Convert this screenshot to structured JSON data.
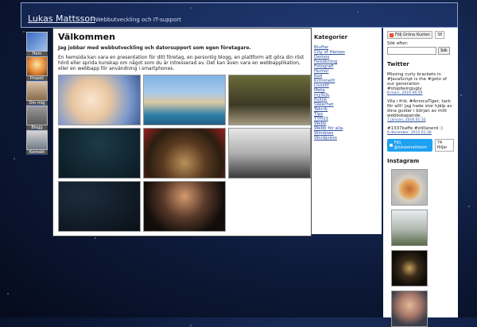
{
  "header": {
    "title": "Lukas Mattsson",
    "tagline": "- Webbutveckling och IT-support"
  },
  "nav": [
    {
      "label": "Hem",
      "icon": "home-icon"
    },
    {
      "label": "Projekt",
      "icon": "project-icon"
    },
    {
      "label": "Om mig",
      "icon": "about-icon"
    },
    {
      "label": "Blogg",
      "icon": "blog-icon"
    },
    {
      "label": "Kontakt",
      "icon": "contact-icon"
    }
  ],
  "main": {
    "title": "Välkommen",
    "lead": "Jag jobbar med webbutveckling och datorsupport som egen företagare.",
    "intro": "En hemsida kan vara en presentation för ditt företag, en personlig blogg, en plattform att göra din röst hörd eller sprida kunskap om något som du är intresserad av. Det kan även vara en webbapplikation, eller en webbapp för användning i smartphones."
  },
  "categories": {
    "title": "Kategorier",
    "items": [
      "Bluffar",
      "City of Heroes",
      "Demos",
      "Felsökning",
      "Fotografi",
      "Humor",
      "Kod",
      "Kriminellt",
      "Livsstil",
      "Meta",
      "mySQL",
      "Politik",
      "Säkerhet",
      "Teknik",
      "Tips",
      "TYPO3",
      "Webb",
      "Webb för alla",
      "Windows",
      "Wordpress"
    ]
  },
  "sidebar": {
    "follow_label": "Följ Gröna Kusten",
    "follow_count": "38",
    "search_label": "Sök efter:",
    "search_value": "",
    "search_button": "Sök",
    "twitter_title": "Twitter",
    "tweets": [
      {
        "text": "Missing curly brackets in #JavaScript is the #goto of our generation #stopbeingugly",
        "date": "8 mars, 2016 06:59"
      },
      {
        "text": "Vila i frid, #AnnicaTiger, tack för allt! Jag hade stor hjälp av dina guider i början av mitt webbskapande.",
        "date": "7 januari, 2016 01:32"
      },
      {
        "text": "#1337kaffe #stillanerd :)",
        "date": "6 december, 2015 01:36"
      }
    ],
    "twitter_follow": "Följ @lukasmattsson",
    "twitter_count": "74 följar",
    "instagram_title": "Instagram"
  },
  "colors": {
    "link": "#2a4fa0",
    "twitter": "#1da1f2",
    "header_text": "#f2f5ff"
  }
}
